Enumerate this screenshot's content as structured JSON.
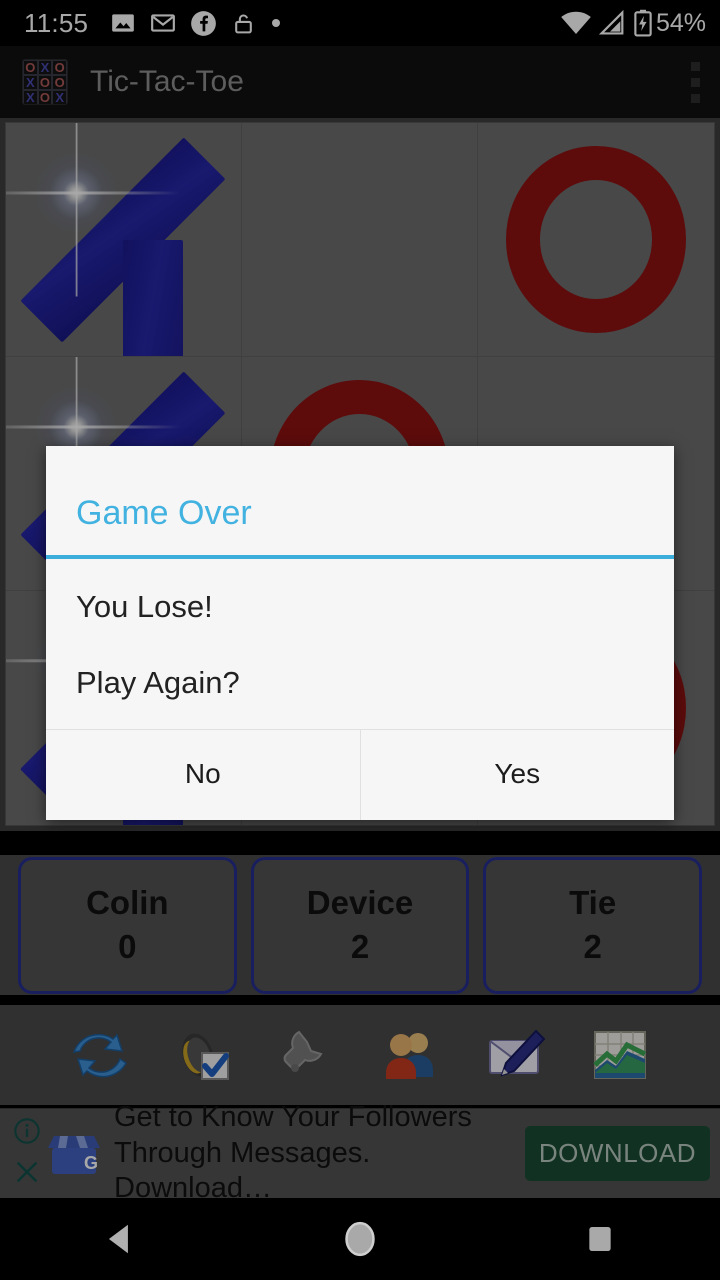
{
  "status_bar": {
    "time": "11:55",
    "battery_percent": "54%",
    "left_icons": [
      "photo-icon",
      "gmail-icon",
      "facebook-icon",
      "unlocked-padlock-icon",
      "dot-icon"
    ],
    "right_icons": [
      "wifi-icon",
      "cell-signal-icon",
      "battery-charging-icon"
    ]
  },
  "app_bar": {
    "title": "Tic-Tac-Toe",
    "icon_grid": [
      "O",
      "X",
      "O",
      "X",
      "O",
      "O",
      "X",
      "O",
      "X"
    ],
    "overflow_label": "more-options"
  },
  "board": {
    "cells": [
      "X",
      "",
      "O",
      "X",
      "O",
      "",
      "X",
      "",
      "O"
    ]
  },
  "dialog": {
    "title": "Game Over",
    "line1": "You Lose!",
    "line2": "Play Again?",
    "button_no": "No",
    "button_yes": "Yes",
    "accent_color": "#3caedc"
  },
  "scores": [
    {
      "name": "Colin",
      "value": "0"
    },
    {
      "name": "Device",
      "value": "2"
    },
    {
      "name": "Tie",
      "value": "2"
    }
  ],
  "tools": [
    {
      "name": "restart-icon"
    },
    {
      "name": "sound-check-icon"
    },
    {
      "name": "settings-wrench-icon"
    },
    {
      "name": "players-icon"
    },
    {
      "name": "compose-mail-icon"
    },
    {
      "name": "statistics-chart-icon"
    }
  ],
  "ad": {
    "line1": "Get to Know Your Followers",
    "line2": "Through Messages. Download…",
    "cta": "DOWNLOAD",
    "cta_color": "#1b4d36"
  },
  "nav_bar": {
    "back": "back-button",
    "home": "home-button",
    "recents": "recents-button"
  },
  "colors": {
    "x_mark": "#2020a0",
    "o_mark": "#8e1212",
    "board_bg": "#6e6e6e",
    "score_border": "#26308f"
  }
}
